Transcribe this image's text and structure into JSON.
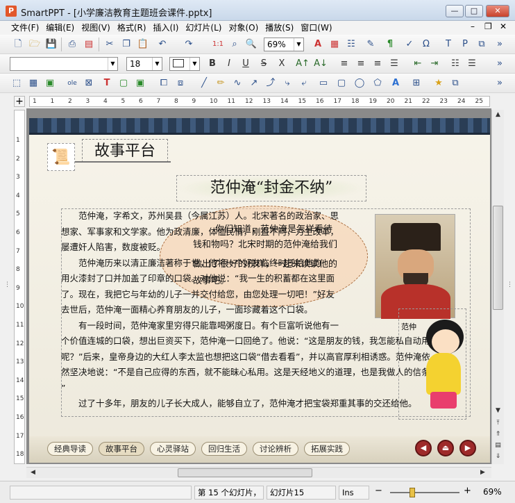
{
  "window": {
    "app_icon": "P",
    "title": "SmartPPT - [小学廉洁教育主题班会课件.pptx]",
    "min": "—",
    "max": "□",
    "close": "✕"
  },
  "menu": [
    "文件(F)",
    "编辑(E)",
    "视图(V)",
    "格式(R)",
    "插入(I)",
    "幻灯片(L)",
    "对象(O)",
    "播放(S)",
    "窗口(W)"
  ],
  "mdi": {
    "min": "–",
    "restore": "❐",
    "close": "✕"
  },
  "toolbar1": {
    "zoom": "69%",
    "more": "»"
  },
  "toolbar2": {
    "font": "",
    "size": "18",
    "bold": "B",
    "italic": "I",
    "underline": "U",
    "more": "»"
  },
  "toolbar3": {
    "more": "»"
  },
  "ruler_h_ticks": [
    "1",
    "1",
    "2",
    "3",
    "4",
    "5",
    "6",
    "7",
    "8",
    "9",
    "10",
    "11",
    "12",
    "13",
    "14",
    "15",
    "16",
    "17",
    "18",
    "19",
    "20",
    "21",
    "22",
    "23",
    "24",
    "25"
  ],
  "ruler_v_ticks": [
    "1",
    "2",
    "3",
    "4",
    "5",
    "6",
    "7",
    "8",
    "9",
    "10",
    "11",
    "12",
    "13",
    "14",
    "15",
    "16",
    "17",
    "18"
  ],
  "slide": {
    "section_title": "故事平台",
    "story_title": "范仲淹“封金不纳”",
    "paragraphs": [
      "　　范仲淹，字希文，苏州吴县（今属江苏）人。北宋著名的政治家、思",
      "想家、军事家和文学家。他为政清廉，体恤民情，刚直不阿，力主改革，",
      "屡遭奸人陷害，数度被贬。",
      "　　范仲淹历来以清正廉洁著称于世，他将一个好友临终时托给他的",
      "用火漆封了口并加盖了印章的口袋。对他说：“我一生的积蓄都在这里面",
      "了。现在，我把它与年幼的儿子一并交付给您，由您处理一切吧！”好友",
      "去世后，范仲淹一面精心养育朋友的儿子，一面珍藏着这个口袋。",
      "　　有一段时间，范仲淹家里穷得只能靠喝粥度日。有个巨富听说他有一",
      "个价值连城的口袋，想出巨资买下，范仲淹一口回绝了。他说：“这是朋友的钱，我怎能私自动用",
      "呢？”后来，皇帝身边的大红人李太监也想把这口袋“借去看看”，并以高官厚利相诱惑。范仲淹依",
      "然坚决地说：“不是自己应得的东西，就不能昧心私用。这是天经地义的道理，也是我做人的信条。",
      "”",
      "　　过了十多年，朋友的儿子长大成人，能够自立了，范仲淹才把宝袋郑重其事的交还给他。"
    ],
    "bubble_lines": [
      "你们知道，范仲淹是怎样看待",
      "钱和物吗？北宋时期的范仲淹给我们",
      "做出了很好的榜样，一起来读读他的",
      "故事吧。"
    ],
    "girl_label": "范仲",
    "nav": [
      "经典导读",
      "故事平台",
      "心灵驿站",
      "回归生活",
      "讨论辨析",
      "拓展实践"
    ],
    "nav_prev": "◀",
    "nav_home": "⏏",
    "nav_next": "▶"
  },
  "scroll": {
    "up": "▲",
    "down": "▼",
    "left": "◀",
    "right": "▶",
    "first": "⤒",
    "prev": "⇑",
    "page": "▤",
    "next": "⇓",
    "last": "⤓",
    "grip": "⋮"
  },
  "status": {
    "total": "第 15 个幻灯片，",
    "current": "幻灯片15",
    "ins": "Ins",
    "zoom": "69%",
    "minus": "−",
    "plus": "+"
  },
  "colors": {
    "accent": "#9e2a2a",
    "roof": "#2a3d55",
    "bubble": "#f7cdaa"
  }
}
